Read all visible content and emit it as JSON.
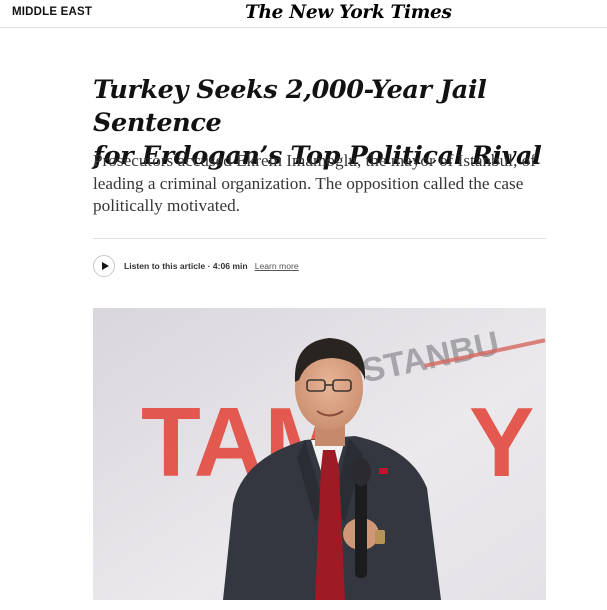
{
  "header": {
    "section": "MIDDLE EAST",
    "logo": "The New York Times"
  },
  "article": {
    "headline_line1": "Turkey Seeks 2,000-Year Jail Sentence",
    "headline_line2": "for Erdogan’s Top Political Rival",
    "summary": "Prosecutors accused Ekrem Imamoglu, the mayor of Istanbul, of leading a criminal organization. The opposition called the case politically motivated."
  },
  "audio": {
    "listen_label": "Listen to this article · 4:06 min",
    "learn_more": "Learn more"
  },
  "photo": {
    "background_sign_top": "STANBU",
    "background_sign_main_left": "TAM",
    "background_sign_main_right": "Y",
    "sign_color": "#e3463b"
  }
}
